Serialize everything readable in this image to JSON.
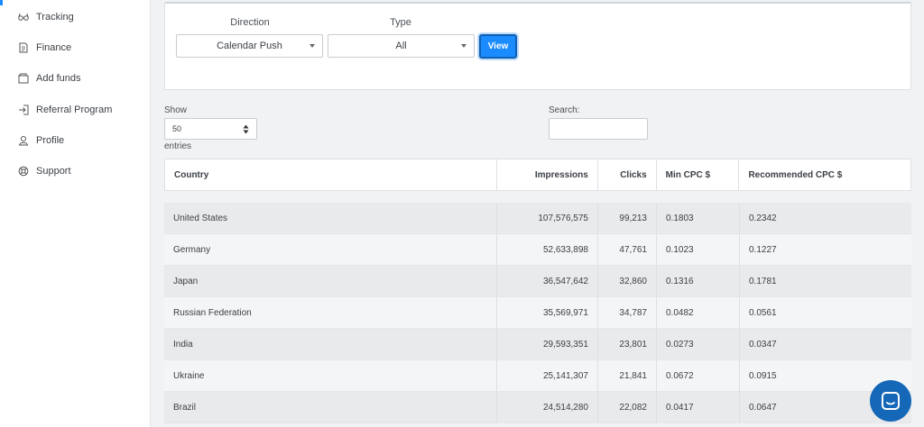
{
  "sidebar": {
    "items": [
      {
        "label": "Tracking",
        "icon": "glasses-icon"
      },
      {
        "label": "Finance",
        "icon": "document-icon"
      },
      {
        "label": "Add funds",
        "icon": "wallet-icon"
      },
      {
        "label": "Referral Program",
        "icon": "sign-in-icon"
      },
      {
        "label": "Profile",
        "icon": "user-icon"
      },
      {
        "label": "Support",
        "icon": "lifebuoy-icon"
      }
    ]
  },
  "filters": {
    "direction_label": "Direction",
    "direction_value": "Calendar Push",
    "type_label": "Type",
    "type_value": "All",
    "view_label": "View"
  },
  "table_controls": {
    "show_label": "Show",
    "show_value": "50",
    "entries_label": "entries",
    "search_label": "Search:",
    "search_value": ""
  },
  "table": {
    "columns": [
      "Country",
      "Impressions",
      "Clicks",
      "Min CPC $",
      "Recommended CPC $"
    ],
    "rows": [
      [
        "United States",
        "107,576,575",
        "99,213",
        "0.1803",
        "0.2342"
      ],
      [
        "Germany",
        "52,633,898",
        "47,761",
        "0.1023",
        "0.1227"
      ],
      [
        "Japan",
        "36,547,642",
        "32,860",
        "0.1316",
        "0.1781"
      ],
      [
        "Russian Federation",
        "35,569,971",
        "34,787",
        "0.0482",
        "0.0561"
      ],
      [
        "India",
        "29,593,351",
        "23,801",
        "0.0273",
        "0.0347"
      ],
      [
        "Ukraine",
        "25,141,307",
        "21,841",
        "0.0672",
        "0.0915"
      ],
      [
        "Brazil",
        "24,514,280",
        "22,082",
        "0.0417",
        "0.0647"
      ]
    ]
  },
  "colors": {
    "accent": "#1a8cff",
    "chat": "#1567b8"
  }
}
